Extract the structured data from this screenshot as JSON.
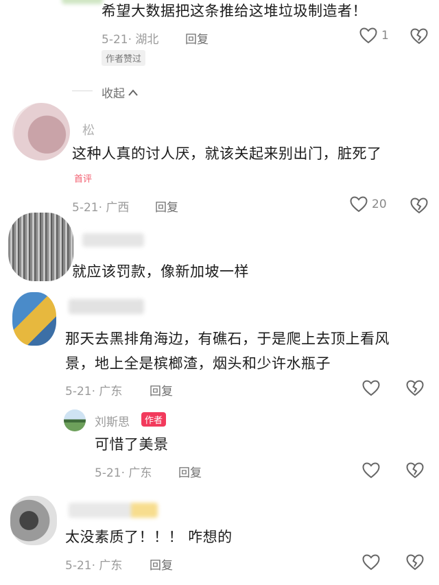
{
  "comments": [
    {
      "text": "希望大数据把这条推给这堆垃圾制造者！",
      "meta": "5-21· 湖北",
      "reply": "回复",
      "likes": "1",
      "badge": "作者赞过",
      "collapse": "收起"
    },
    {
      "name": "松",
      "text": "这种人真的讨人厌，就该关起来别出门，脏死了",
      "badge": "首评",
      "meta": "5-21· 广西",
      "reply": "回复",
      "likes": "20"
    },
    {
      "text": "就应该罚款，像新加坡一样"
    },
    {
      "text_line1": "那天去黑排角海边，有礁石，于是爬上去顶上看风",
      "text_line2": "景，地上全是槟榔渣，烟头和少许水瓶子",
      "meta": "5-21· 广东",
      "reply": "回复",
      "sub_reply": {
        "name": "刘斯思",
        "badge": "作者",
        "text": "可惜了美景",
        "meta": "5-21· 广东",
        "reply": "回复"
      }
    },
    {
      "text": "太没素质了！！！ 咋想的",
      "meta": "5-21· 广东",
      "reply": "回复"
    }
  ],
  "colors": {
    "accent": "#f23a5c",
    "meta": "#9a9a9a",
    "text": "#1c1c1c"
  },
  "icons": [
    "heart-icon",
    "broken-heart-icon",
    "chevron-up-icon"
  ]
}
